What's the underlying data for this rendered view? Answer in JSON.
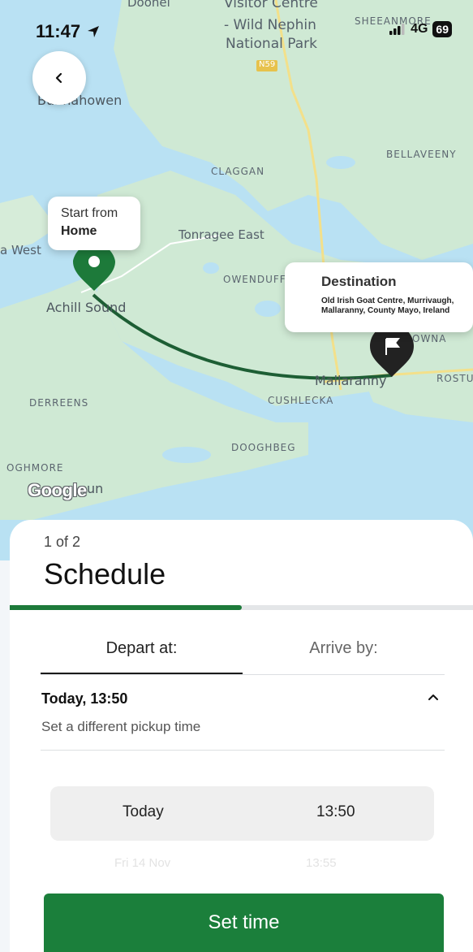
{
  "status_bar": {
    "time": "11:47",
    "network": "4G",
    "battery": "69"
  },
  "map": {
    "labels": {
      "doonel": "Doonel",
      "visitor_1": "Visitor Centre",
      "visitor_2": "- Wild Nephin",
      "visitor_3": "National Park",
      "sheeanmore": "SHEEANMORE",
      "road": "N59",
      "bellaveeny": "BELLAVEENY",
      "claggan": "CLAGGAN",
      "bunnahowen": "Bunnahowen",
      "tonragee": "Tonragee East",
      "west": "a West",
      "owenduff": "OWENDUFF",
      "achill": "Achill Sound",
      "nowna": "OWNA",
      "mallaranny": "Mallaranny",
      "rostu": "ROSTU",
      "derreens": "DERREENS",
      "cushlecka": "CUSHLECKA",
      "dooghbeg": "DOOGHBEG",
      "oghmore": "OGHMORE",
      "un": "un"
    },
    "start_marker": {
      "line1": "Start from",
      "line2": "Home"
    },
    "destination_marker": {
      "title": "Destination",
      "address": "Old Irish Goat Centre, Murrivaugh, Mallaranny, County Mayo, Ireland"
    },
    "attribution": "Google",
    "colors": {
      "water": "#b9e1f3",
      "land": "#cfe9d4",
      "route": "#1d5e34",
      "start_pin": "#1d7a3a",
      "destination_pin": "#222222"
    }
  },
  "sheet": {
    "step": "1 of 2",
    "title": "Schedule",
    "progress": 0.5,
    "tabs": {
      "depart": "Depart at:",
      "arrive": "Arrive by:"
    },
    "pickup": {
      "when": "Today, 13:50",
      "hint": "Set a different pickup time"
    },
    "picker": {
      "selected_day": "Today",
      "selected_time": "13:50",
      "next_day": "Fri 14 Nov",
      "next_time": "13:55"
    },
    "cta": "Set time",
    "accent": "#1b7f3b"
  }
}
